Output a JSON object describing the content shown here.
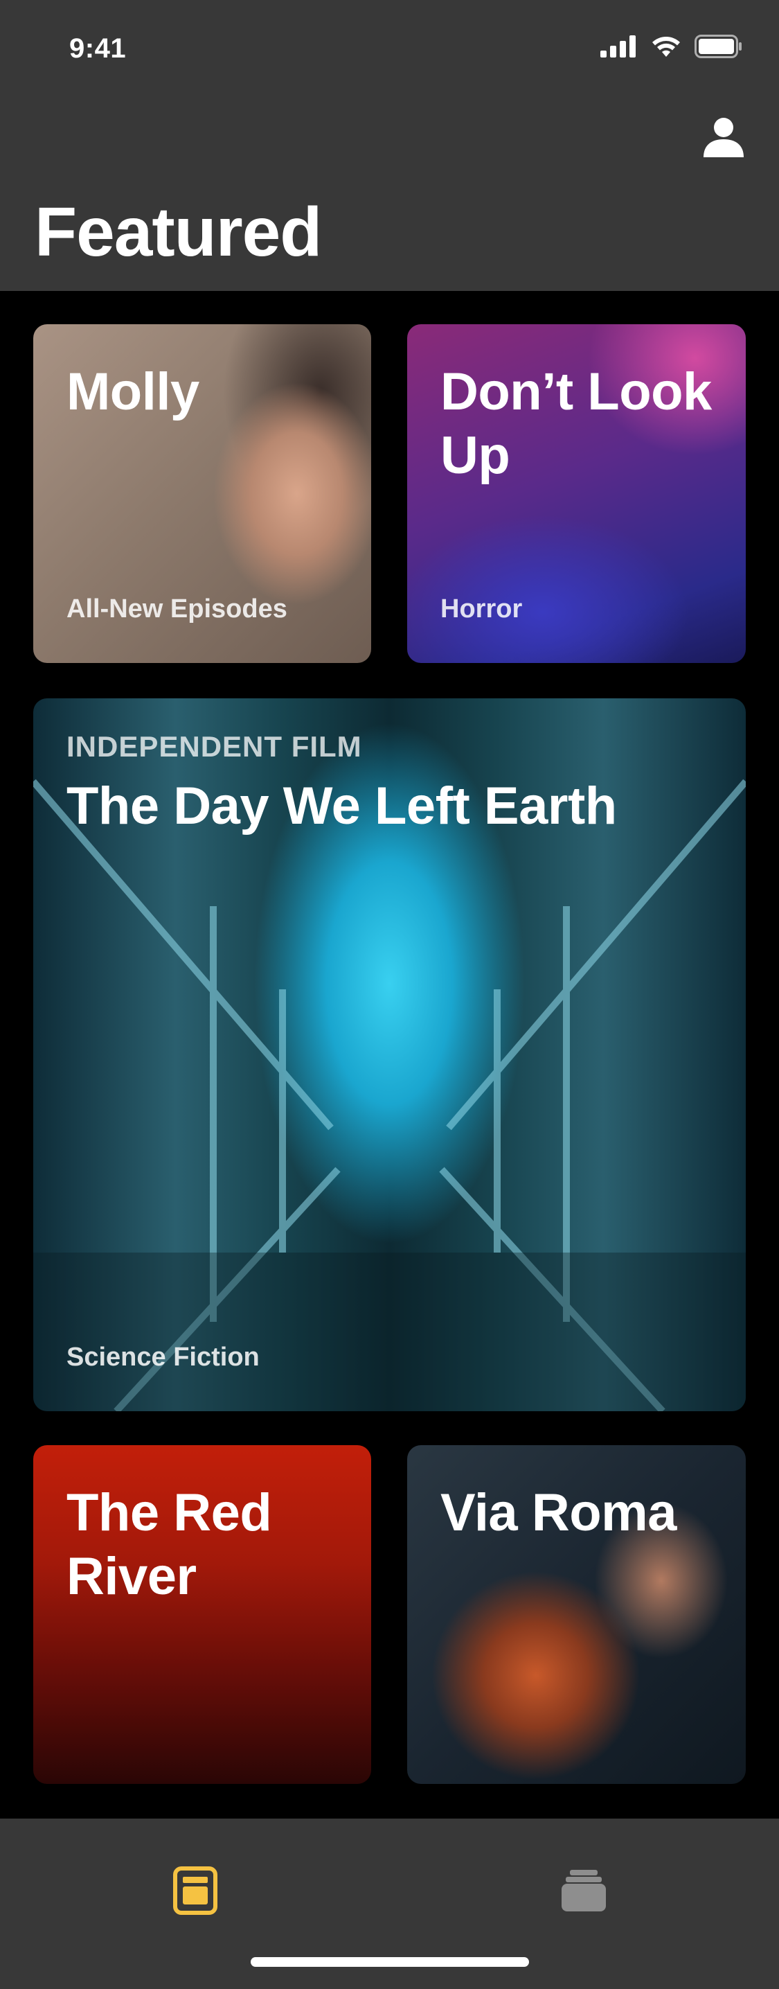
{
  "status_bar": {
    "time": "9:41"
  },
  "header": {
    "title": "Featured",
    "profile_icon": "person-icon"
  },
  "cards": {
    "molly": {
      "title": "Molly",
      "subtitle": "All-New Episodes"
    },
    "dont_look_up": {
      "title": "Don’t Look Up",
      "subtitle": "Horror"
    },
    "day_we_left_earth": {
      "eyebrow": "INDEPENDENT FILM",
      "title": "The Day We Left Earth",
      "subtitle": "Science Fiction"
    },
    "red_river": {
      "title": "The Red River"
    },
    "via_roma": {
      "title": "Via Roma"
    }
  },
  "tab_bar": {
    "items": [
      {
        "icon": "featured-tab-icon",
        "active": true,
        "color": "#F5C242"
      },
      {
        "icon": "library-tab-icon",
        "active": false,
        "color": "#8E8E8E"
      }
    ]
  },
  "colors": {
    "accent": "#F5C242",
    "header_bg": "#383838"
  }
}
